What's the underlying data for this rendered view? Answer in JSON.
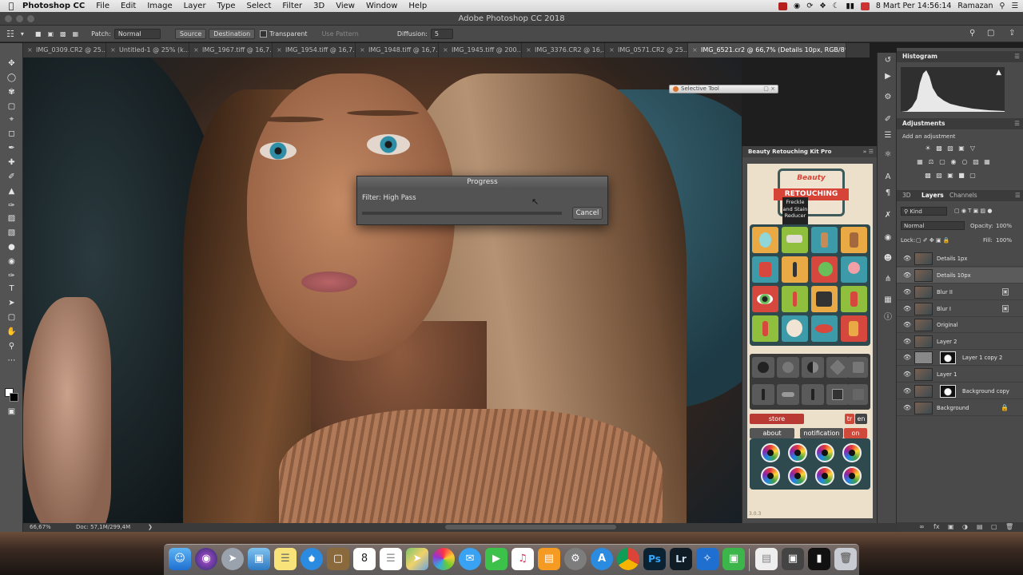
{
  "menubar": {
    "app": "Photoshop CC",
    "items": [
      "File",
      "Edit",
      "Image",
      "Layer",
      "Type",
      "Select",
      "Filter",
      "3D",
      "View",
      "Window",
      "Help"
    ],
    "clock": "8 Mart Per  14:56:14",
    "user": "Ramazan"
  },
  "window": {
    "title": "Adobe Photoshop CC 2018"
  },
  "options": {
    "patch_label": "Patch:",
    "patch_mode": "Normal",
    "source": "Source",
    "destination": "Destination",
    "transparent": "Transparent",
    "use_pattern": "Use Pattern",
    "diffusion_label": "Diffusion:",
    "diffusion_value": "5"
  },
  "tabs": [
    "IMG_0309.CR2 @ 25...",
    "Untitled-1 @ 25% (k...",
    "IMG_1967.tiff @ 16,7...",
    "IMG_1954.tiff @ 16,7...",
    "IMG_1948.tiff @ 16,7...",
    "IMG_1945.tiff @ 200...",
    "IMG_3376.CR2 @ 16,...",
    "IMG_0571.CR2 @ 25...",
    "IMG_6521.cr2 @ 66,7% (Details 10px, RGB/8*) *"
  ],
  "progress": {
    "title": "Progress",
    "message": "Filter: High Pass",
    "cancel": "Cancel"
  },
  "selective_tool": {
    "title": "Selective Tool"
  },
  "plugin": {
    "title": "Beauty Retouching Kit Pro",
    "logo_top": "Beauty",
    "logo_banner": "RETOUCHING",
    "tooltip": "Freckle and Stain Reducer",
    "store": "store",
    "lang_tr": "tr",
    "lang_en": "en",
    "about": "about",
    "notification": "notification",
    "on": "on",
    "version": "3.0.3"
  },
  "panels": {
    "histogram": "Histogram",
    "adjustments": "Adjustments",
    "add_adjustment": "Add an adjustment",
    "tab_3d": "3D",
    "tab_layers": "Layers",
    "tab_channels": "Channels",
    "kind": "Kind",
    "blend": "Normal",
    "opacity_label": "Opacity:",
    "opacity": "100%",
    "lock_label": "Lock:",
    "fill_label": "Fill:",
    "fill": "100%"
  },
  "layers": [
    {
      "name": "Details 1px"
    },
    {
      "name": "Details 10px"
    },
    {
      "name": "Blur II"
    },
    {
      "name": "Blur I"
    },
    {
      "name": "Original"
    },
    {
      "name": "Layer 2"
    },
    {
      "name": "Layer 1 copy 2"
    },
    {
      "name": "Layer 1"
    },
    {
      "name": "Background copy"
    },
    {
      "name": "Background"
    }
  ],
  "status": {
    "zoom": "66,67%",
    "doc": "Doc: 57,1M/299,4M"
  },
  "dock": {
    "calendar_day": "8",
    "icons": [
      "finder-icon",
      "siri-icon",
      "launchpad-icon",
      "preview-icon",
      "notes-icon",
      "safari-icon",
      "folder-icon",
      "calendar-icon",
      "reminders-icon",
      "maps-icon",
      "photos-icon",
      "messages-icon",
      "facetime-icon",
      "music-icon",
      "books-icon",
      "system-preferences-icon",
      "app-store-icon",
      "chrome-icon",
      "photoshop-icon",
      "lightroom-icon",
      "bluetooth-icon",
      "numbers-icon",
      "document-icon",
      "screen-icon",
      "terminal-icon",
      "trash-icon"
    ],
    "ps": "Ps",
    "lr": "Lr"
  },
  "colors": {
    "accent": "#2d8ea6",
    "store_red": "#b93a32",
    "on_red": "#cf4a3a"
  }
}
